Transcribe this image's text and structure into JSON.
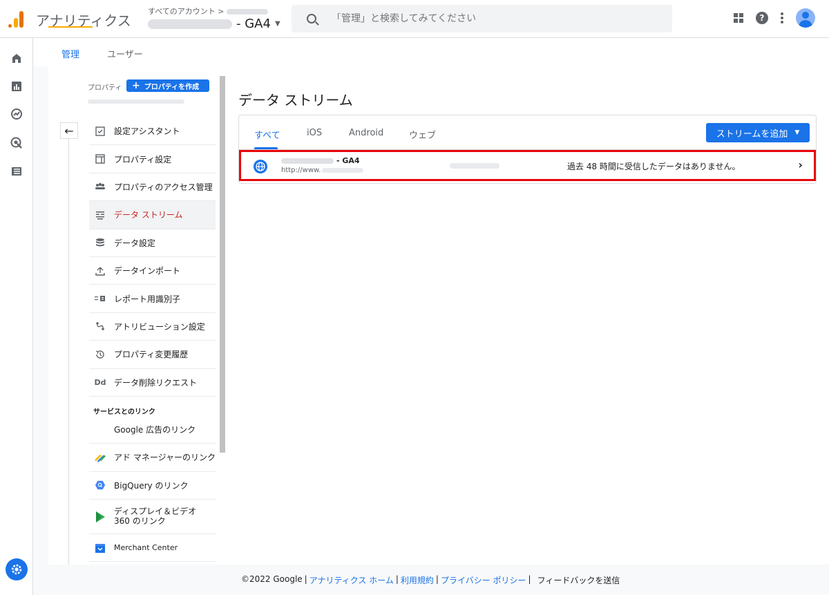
{
  "header": {
    "app_title": "アナリティクス",
    "account_crumb": "すべてのアカウント >",
    "property_suffix": "- GA4",
    "search_placeholder": "「管理」と検索してみてください"
  },
  "admin_tabs": {
    "admin": "管理",
    "user": "ユーザー"
  },
  "property_panel": {
    "label": "プロパティ",
    "create_button": "プロパティを作成"
  },
  "nav": {
    "items": [
      {
        "label": "設定アシスタント",
        "icon": "checkbox-icon"
      },
      {
        "label": "プロパティ設定",
        "icon": "layout-icon"
      },
      {
        "label": "プロパティのアクセス管理",
        "icon": "people-icon"
      },
      {
        "label": "データ ストリーム",
        "icon": "stream-icon",
        "active": true
      },
      {
        "label": "データ設定",
        "icon": "database-icon"
      },
      {
        "label": "データインポート",
        "icon": "upload-icon"
      },
      {
        "label": "レポート用識別子",
        "icon": "identifier-icon"
      },
      {
        "label": "アトリビューション設定",
        "icon": "attribution-icon"
      },
      {
        "label": "プロパティ変更履歴",
        "icon": "history-icon"
      },
      {
        "label": "データ削除リクエスト",
        "icon": "delete-data-icon"
      }
    ],
    "section_title": "サービスとのリンク",
    "links": [
      {
        "label": "Google 広告のリンク"
      },
      {
        "label": "アド マネージャーのリンク",
        "icon": "ad-manager-icon"
      },
      {
        "label": "BigQuery のリンク",
        "icon": "bigquery-icon"
      },
      {
        "label": "ディスプレイ＆ビデオ 360 のリンク",
        "icon": "dv360-icon"
      },
      {
        "label": "Merchant Center",
        "icon": "merchant-center-icon"
      }
    ]
  },
  "main": {
    "title": "データ ストリーム",
    "tabs": [
      "すべて",
      "iOS",
      "Android",
      "ウェブ"
    ],
    "add_button": "ストリームを追加",
    "stream": {
      "name_suffix": "- GA4",
      "url_prefix": "http://www.",
      "status": "過去 48 時間に受信したデータはありません。"
    }
  },
  "footer": {
    "copyright": "©2022 Google",
    "links": [
      "アナリティクス ホーム",
      "利用規約",
      "プライバシー ポリシー"
    ],
    "feedback": "フィードバックを送信"
  },
  "colors": {
    "accent": "#1a73e8",
    "highlight": "#e8060a",
    "active_nav": "#c5221f",
    "tab_underline_admin": "#f9ab00"
  }
}
